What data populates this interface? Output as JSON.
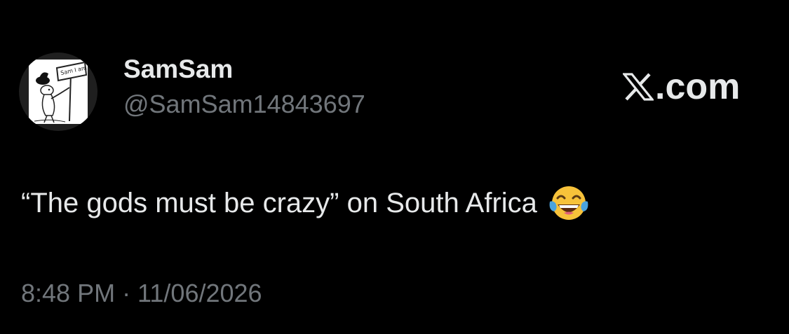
{
  "author": {
    "display_name": "SamSam",
    "handle": "@SamSam14843697",
    "avatar_icon": "cartoon-character-with-sign-avatar",
    "avatar_sign_text": "Sam I am"
  },
  "brand": {
    "label": ".com",
    "logo_icon": "x-logo-icon"
  },
  "tweet": {
    "text": "“The gods must be crazy” on South Africa",
    "emoji_icon": "face-with-tears-of-joy-emoji"
  },
  "meta": {
    "timestamp": "8:48 PM · 11/06/2026"
  },
  "colors": {
    "background": "#000000",
    "primary_text": "#e7e9ea",
    "secondary_text": "#71767b",
    "emoji_yellow": "#f7c23a",
    "tear_blue": "#4aa3df"
  }
}
